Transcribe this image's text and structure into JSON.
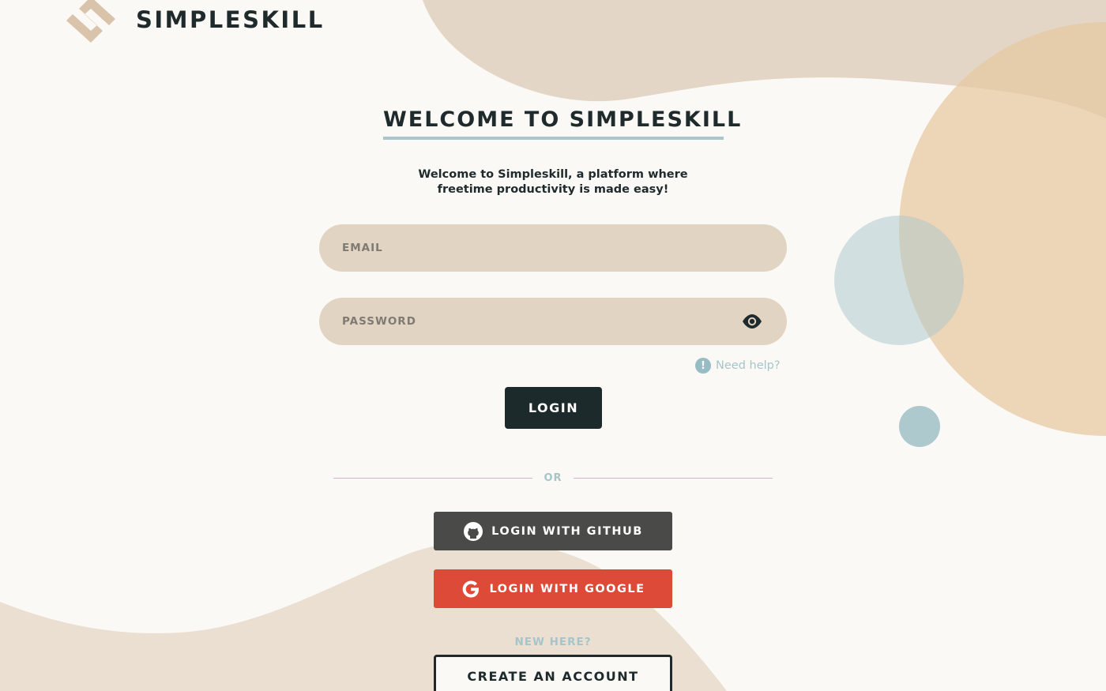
{
  "brand": {
    "name": "SIMPLESKILL",
    "logo_icon": "simpleskill-logo-icon"
  },
  "welcome": {
    "title": "WELCOME TO SIMPLESKILL",
    "subtitle_line1": "Welcome to Simpleskill, a platform where",
    "subtitle_line2": "freetime productivity is made easy!"
  },
  "form": {
    "email_placeholder": "EMAIL",
    "email_value": "",
    "password_placeholder": "PASSWORD",
    "password_value": "",
    "toggle_visibility_icon": "eye-icon",
    "help_icon": "info-icon",
    "help_text": "Need help?",
    "login_label": "LOGIN"
  },
  "divider": {
    "or_label": "OR"
  },
  "oauth": {
    "github_label": "LOGIN WITH GITHUB",
    "github_icon": "github-icon",
    "google_label": "LOGIN WITH GOOGLE",
    "google_icon": "google-icon"
  },
  "signup": {
    "prompt": "NEW HERE?",
    "create_label": "CREATE AN ACCOUNT"
  },
  "colors": {
    "background": "#fbf9f5",
    "dark": "#1e2a2c",
    "field": "#e2d4c3",
    "accent_blue": "#a9c6cb",
    "github": "#4a4a49",
    "google": "#de4a38",
    "blob_beige": "#e2d4c3",
    "blob_orange": "#e6c8a0"
  }
}
